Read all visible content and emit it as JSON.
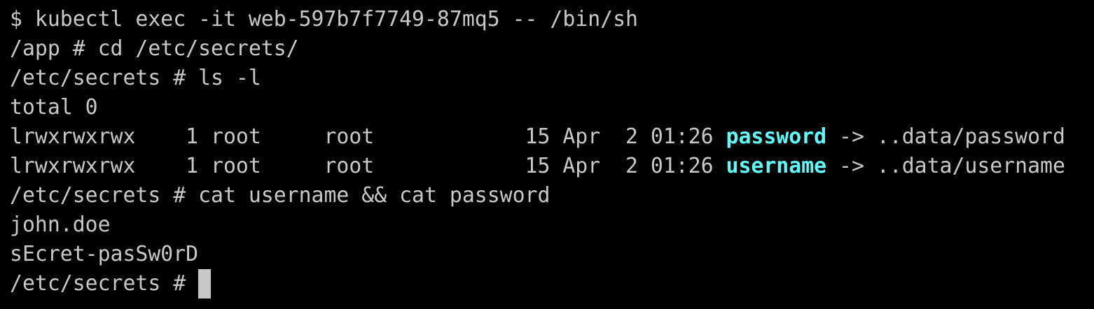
{
  "terminal": {
    "lines": [
      "$ kubectl exec -it web-597b7f7749-87mq5 -- /bin/sh",
      "/app # cd /etc/secrets/",
      "/etc/secrets # ls -l",
      "total 0"
    ],
    "ls_entries": [
      {
        "prefix": "lrwxrwxrwx    1 root     root            15 Apr  2 01:26 ",
        "name": "password",
        "target": " -> ..data/password"
      },
      {
        "prefix": "lrwxrwxrwx    1 root     root            15 Apr  2 01:26 ",
        "name": "username",
        "target": " -> ..data/username"
      }
    ],
    "after": [
      "/etc/secrets # cat username && cat password",
      "john.doe",
      "sEcret-pasSw0rD"
    ],
    "prompt": "/etc/secrets # ",
    "colors": {
      "text": "#c8c8c8",
      "symlink": "#5ffcfc",
      "background": "#000000"
    }
  }
}
